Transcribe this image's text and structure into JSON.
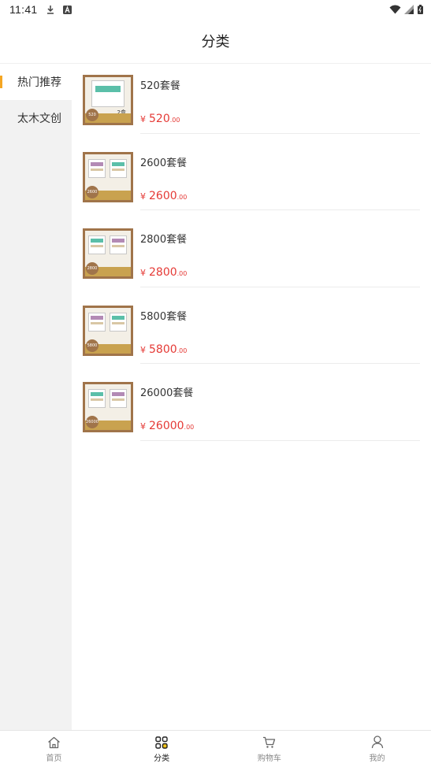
{
  "status_bar": {
    "time": "11:41",
    "icons": [
      "download-icon",
      "a-notification-icon",
      "wifi-icon",
      "signal-icon",
      "battery-icon"
    ]
  },
  "header": {
    "title": "分类"
  },
  "sidebar": {
    "items": [
      {
        "label": "热门推荐",
        "active": true
      },
      {
        "label": "太木文创",
        "active": false
      }
    ]
  },
  "products": [
    {
      "name": "520套餐",
      "currency": "¥",
      "price_int": "520",
      "price_dec": ".00",
      "badge": "520",
      "qty": "2盒"
    },
    {
      "name": "2600套餐",
      "currency": "¥",
      "price_int": "2600",
      "price_dec": ".00",
      "badge": "2600"
    },
    {
      "name": "2800套餐",
      "currency": "¥",
      "price_int": "2800",
      "price_dec": ".00",
      "badge": "2800"
    },
    {
      "name": "5800套餐",
      "currency": "¥",
      "price_int": "5800",
      "price_dec": ".00",
      "badge": "5800"
    },
    {
      "name": "26000套餐",
      "currency": "¥",
      "price_int": "26000",
      "price_dec": ".00",
      "badge": "26000"
    }
  ],
  "tabbar": {
    "tabs": [
      {
        "label": "首页",
        "icon": "home-icon"
      },
      {
        "label": "分类",
        "icon": "category-grid-icon",
        "active": true
      },
      {
        "label": "购物车",
        "icon": "cart-icon"
      },
      {
        "label": "我的",
        "icon": "user-icon"
      }
    ]
  },
  "colors": {
    "accent": "#f5a623",
    "price": "#e53935",
    "sidebar_bg": "#f2f2f2"
  }
}
